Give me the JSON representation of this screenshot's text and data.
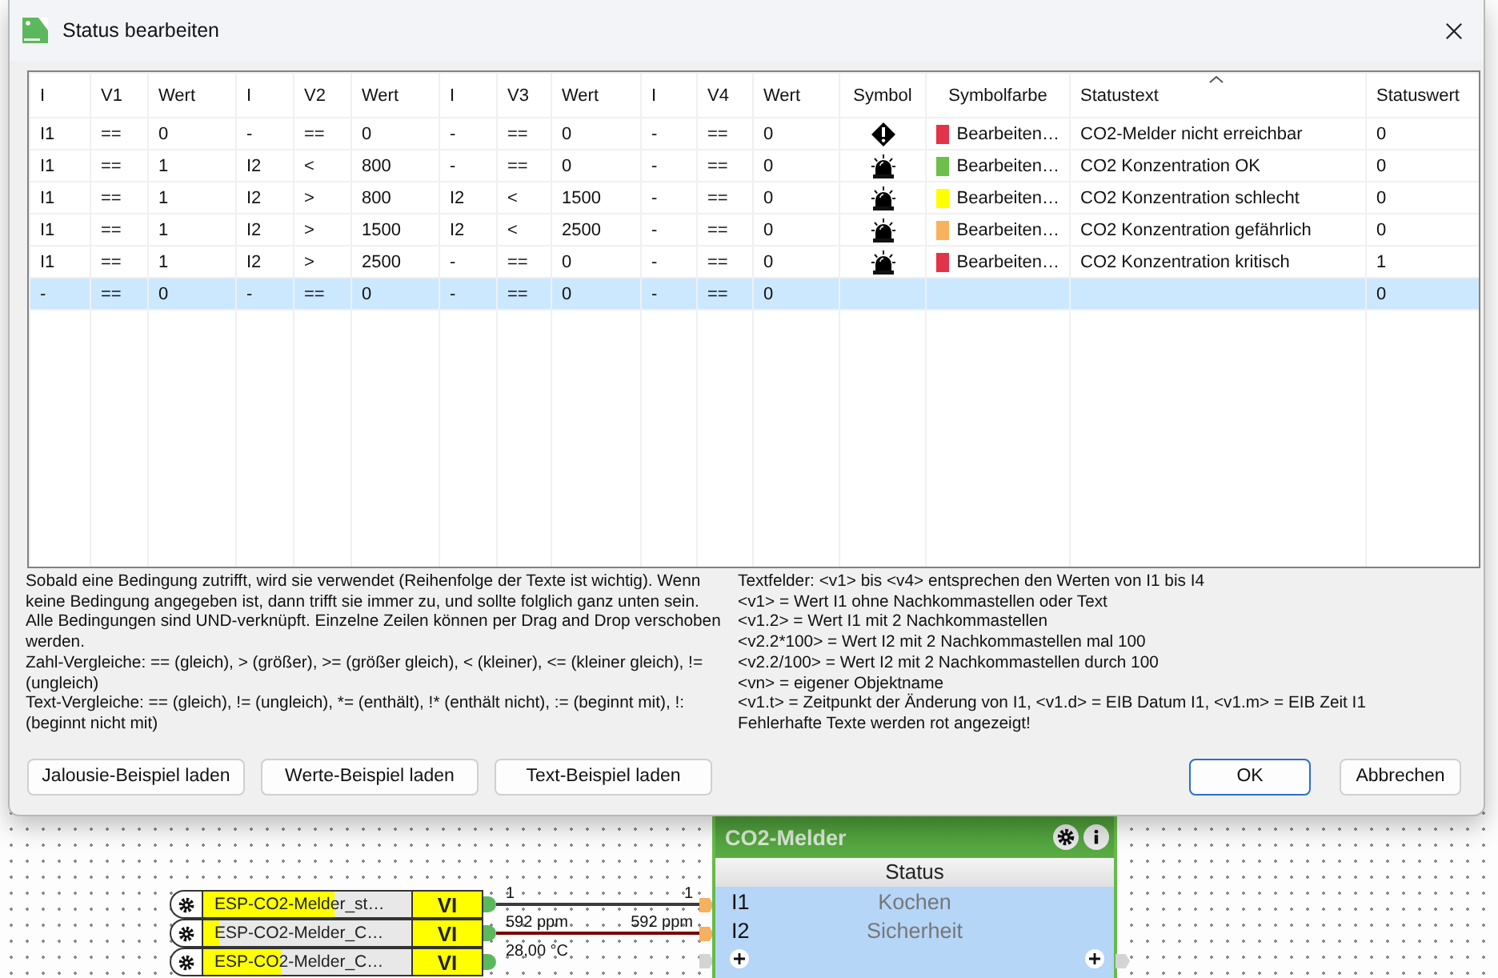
{
  "window": {
    "title": "Status bearbeiten"
  },
  "table": {
    "columns": [
      "I",
      "V1",
      "Wert",
      "I",
      "V2",
      "Wert",
      "I",
      "V3",
      "Wert",
      "I",
      "V4",
      "Wert",
      "Symbol",
      "Symbolfarbe",
      "Statustext",
      "Statuswert"
    ],
    "rows": [
      {
        "cells": [
          "I1",
          "==",
          "0",
          "-",
          "==",
          "0",
          "-",
          "==",
          "0",
          "-",
          "==",
          "0"
        ],
        "kind": "warning",
        "color": "#e3334a",
        "color_text": "Bearbeiten…",
        "status_text": "CO2-Melder nicht erreichbar",
        "status_value": "0",
        "selected": false
      },
      {
        "cells": [
          "I1",
          "==",
          "1",
          "I2",
          "<",
          "800",
          "-",
          "==",
          "0",
          "-",
          "==",
          "0"
        ],
        "kind": "siren",
        "color": "#6cc04a",
        "color_text": "Bearbeiten…",
        "status_text": "CO2 Konzentration OK",
        "status_value": "0",
        "selected": false
      },
      {
        "cells": [
          "I1",
          "==",
          "1",
          "I2",
          ">",
          "800",
          "I2",
          "<",
          "1500",
          "-",
          "==",
          "0"
        ],
        "kind": "siren",
        "color": "#ffff00",
        "color_text": "Bearbeiten…",
        "status_text": "CO2 Konzentration schlecht",
        "status_value": "0",
        "selected": false
      },
      {
        "cells": [
          "I1",
          "==",
          "1",
          "I2",
          ">",
          "1500",
          "I2",
          "<",
          "2500",
          "-",
          "==",
          "0"
        ],
        "kind": "siren",
        "color": "#f7b35c",
        "color_text": "Bearbeiten…",
        "status_text": "CO2 Konzentration gefährlich",
        "status_value": "0",
        "selected": false
      },
      {
        "cells": [
          "I1",
          "==",
          "1",
          "I2",
          ">",
          "2500",
          "-",
          "==",
          "0",
          "-",
          "==",
          "0"
        ],
        "kind": "siren",
        "color": "#e3334a",
        "color_text": "Bearbeiten…",
        "status_text": "CO2 Konzentration kritisch",
        "status_value": "1",
        "selected": false
      },
      {
        "cells": [
          "-",
          "==",
          "0",
          "-",
          "==",
          "0",
          "-",
          "==",
          "0",
          "-",
          "==",
          "0"
        ],
        "status_value": "0",
        "selected": true
      }
    ]
  },
  "help_left": [
    "Sobald eine Bedingung zutrifft, wird sie verwendet (Reihenfolge der Texte ist wichtig). Wenn keine Bedingung angegeben ist, dann trifft sie immer zu, und sollte folglich ganz unten sein.",
    "Alle Bedingungen sind UND-verknüpft. Einzelne Zeilen können per Drag and Drop verschoben werden.",
    "Zahl-Vergleiche: == (gleich), > (größer), >= (größer gleich), < (kleiner), <= (kleiner gleich), != (ungleich)",
    "Text-Vergleiche: == (gleich), != (ungleich), *= (enthält), !* (enthält nicht), := (beginnt mit), !: (beginnt nicht mit)"
  ],
  "help_right": [
    "Textfelder: <v1> bis <v4> entsprechen den Werten von I1 bis I4",
    "<v1> = Wert I1 ohne Nachkommastellen oder Text",
    "<v1.2> = Wert I1 mit 2 Nachkommastellen",
    "<v2.2*100> = Wert I2 mit 2 Nachkommastellen mal 100",
    "<v2.2/100> = Wert I2 mit 2 Nachkommastellen durch 100",
    "<vn> = eigener Objektname",
    "<v1.t> = Zeitpunkt der Änderung von I1, <v1.d> = EIB Datum I1, <v1.m> = EIB Zeit I1",
    "Fehlerhafte Texte werden rot angezeigt!"
  ],
  "example_buttons": [
    "Jalousie-Beispiel laden",
    "Werte-Beispiel laden",
    "Text-Beispiel laden"
  ],
  "dialog_buttons": [
    {
      "label": "OK",
      "default": true
    },
    {
      "label": "Abbrechen",
      "default": false
    }
  ],
  "canvas": {
    "inputs": [
      {
        "name": "ESP-CO2-Melder_st…",
        "tag": "VI",
        "level": 0.63,
        "value": "1",
        "wire": {
          "color": "#3c3c3c",
          "end_label": "1"
        }
      },
      {
        "name": "ESP-CO2-Melder_C…",
        "tag": "VI",
        "level": 0.08,
        "value": "592 ppm",
        "wire": {
          "color": "#7a0000",
          "end_label": "592 ppm"
        }
      },
      {
        "name": "ESP-CO2-Melder_C…",
        "tag": "VI",
        "level": 0.38,
        "value": "28,00 °C"
      }
    ],
    "block": {
      "title": "CO2-Melder",
      "subtitle": "Status",
      "inputs": [
        {
          "port": "I1",
          "label": "Kochen"
        },
        {
          "port": "I2",
          "label": "Sicherheit"
        }
      ]
    }
  }
}
